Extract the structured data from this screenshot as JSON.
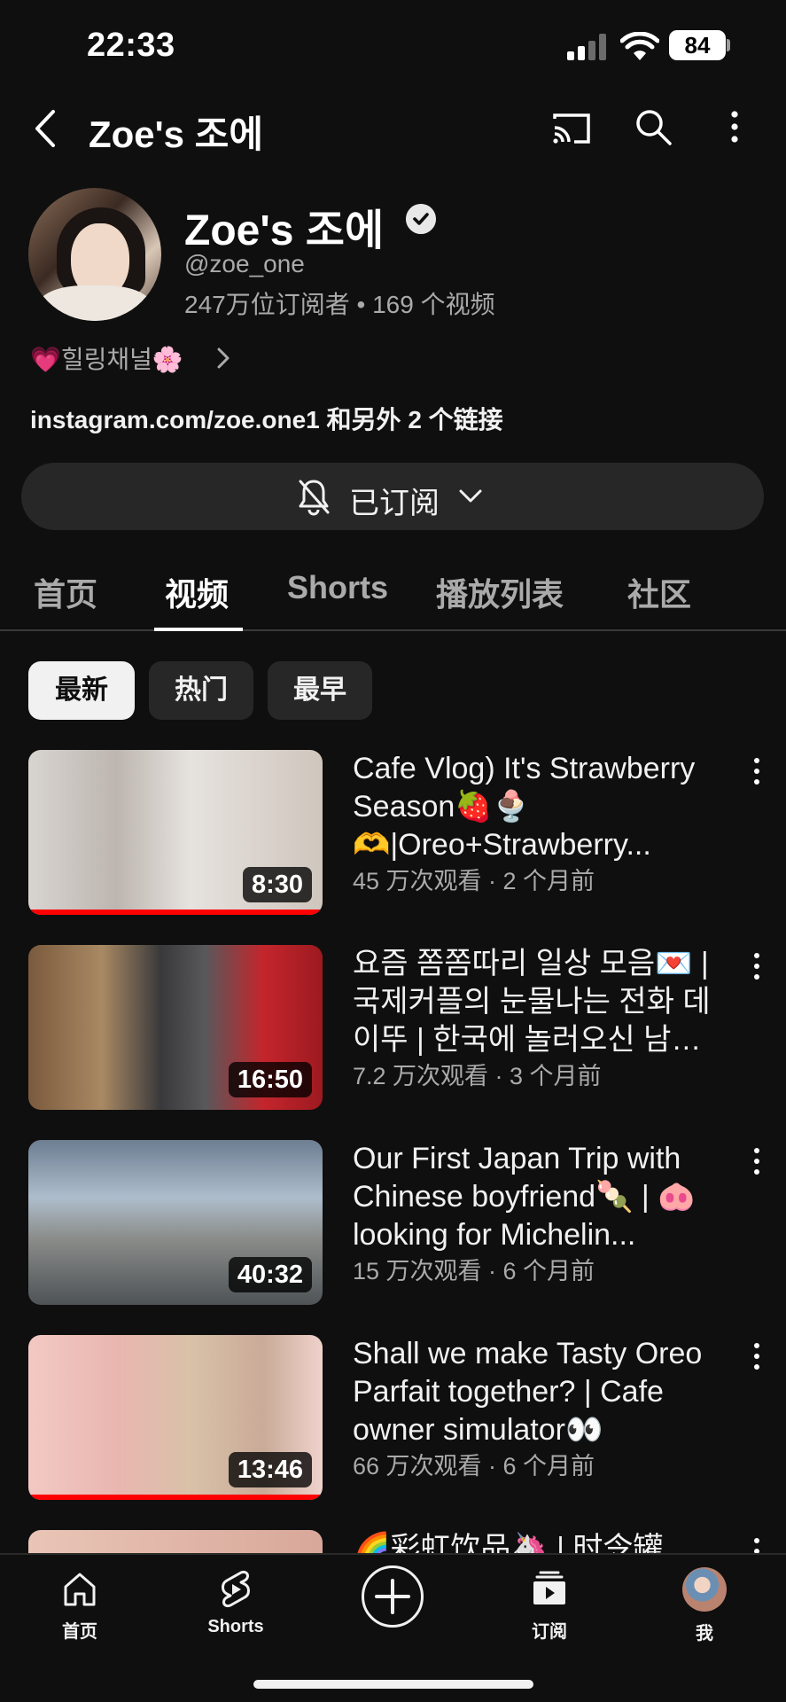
{
  "status_bar": {
    "time": "22:33",
    "battery": "84"
  },
  "app_bar": {
    "title": "Zoe's 조에"
  },
  "channel": {
    "name": "Zoe's 조에",
    "handle": "@zoe_one",
    "stats": "247万位订阅者 • 169 个视频",
    "description": "💗힐링채널🌸",
    "links": "instagram.com/zoe.one1 和另外 2 个链接",
    "subscribe_label": "已订阅"
  },
  "tabs": [
    {
      "label": "首页"
    },
    {
      "label": "视频"
    },
    {
      "label": "Shorts"
    },
    {
      "label": "播放列表"
    },
    {
      "label": "社区"
    }
  ],
  "active_tab": "视频",
  "chips": [
    {
      "label": "最新"
    },
    {
      "label": "热门"
    },
    {
      "label": "最早"
    }
  ],
  "videos": [
    {
      "title": "Cafe Vlog) It's Strawberry Season🍓🍨🫶|Oreo+Strawberry...",
      "duration": "8:30",
      "meta": "45 万次观看 · 2 个月前",
      "watched_fraction": 1.0
    },
    {
      "title": "요즘 쫌쫌따리 일상 모음💌 | 국제커플의 눈물나는 전화 데이뚜 | 한국에 놀러오신 남…",
      "duration": "16:50",
      "meta": "7.2 万次观看 · 3 个月前",
      "watched_fraction": 0
    },
    {
      "title": "Our First Japan Trip with Chinese boyfriend🍡 | 🐽looking for Michelin...",
      "duration": "40:32",
      "meta": "15 万次观看 · 6 个月前",
      "watched_fraction": 0
    },
    {
      "title": "Shall we make Tasty Oreo Parfait together? | Cafe owner simulator👀",
      "duration": "13:46",
      "meta": "66 万次观看 · 6 个月前",
      "watched_fraction": 1.0
    },
    {
      "title": "🌈彩虹饮品🦄 | 时令罐",
      "duration": "",
      "meta": "",
      "watched_fraction": 0
    }
  ],
  "bottom_nav": [
    {
      "label": "首页",
      "icon": "home-icon"
    },
    {
      "label": "Shorts",
      "icon": "shorts-icon"
    },
    {
      "label": "",
      "icon": "create-icon"
    },
    {
      "label": "订阅",
      "icon": "subscriptions-icon"
    },
    {
      "label": "我",
      "icon": "avatar"
    }
  ],
  "colors": {
    "background": "#0f0f0f",
    "chip": "#272727",
    "progress": "#ff0000",
    "secondary_text": "#aaaaaa"
  }
}
